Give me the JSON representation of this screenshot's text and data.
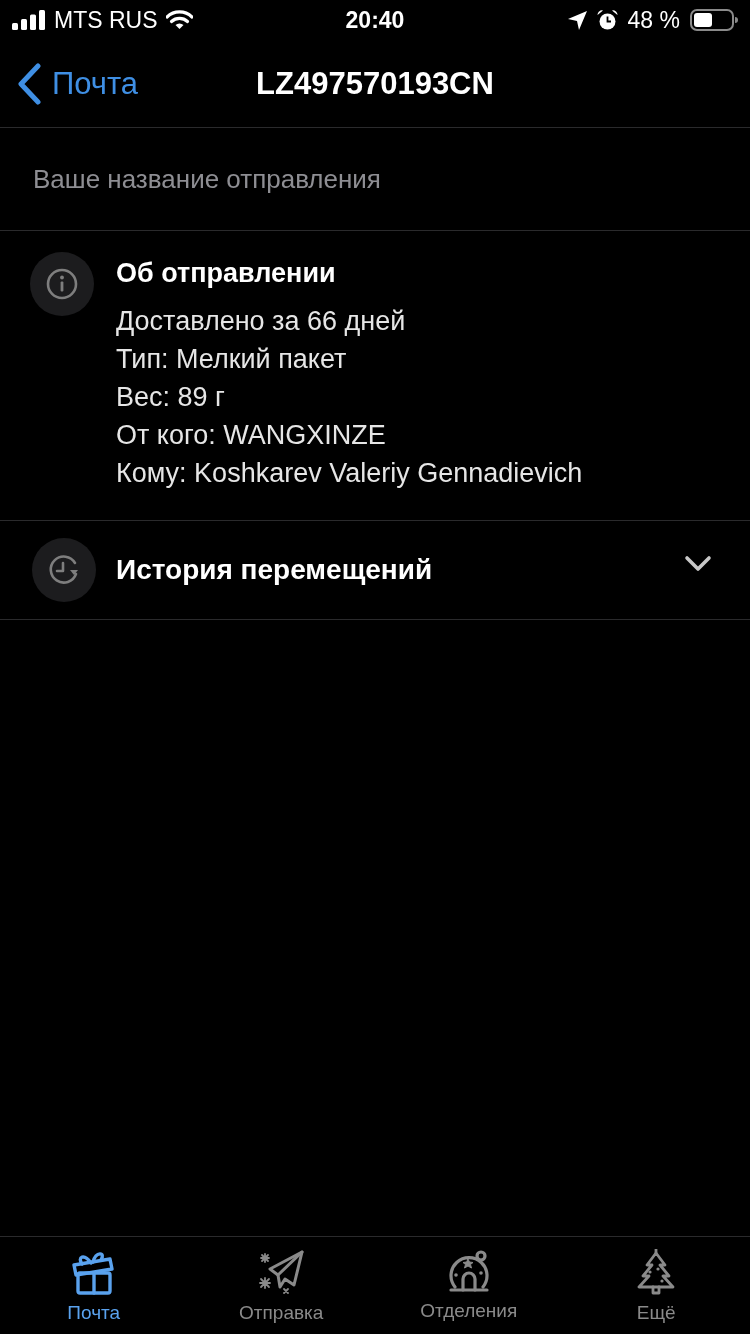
{
  "status_bar": {
    "carrier": "MTS RUS",
    "time": "20:40",
    "battery": "48 %"
  },
  "nav": {
    "back_label": "Почта",
    "title": "LZ497570193CN"
  },
  "name_field": {
    "placeholder": "Ваше название отправления"
  },
  "sections": [
    {
      "kind": "details",
      "title": "Об отправлении",
      "lines": [
        "Доставлено за 66 дней",
        "Тип: Мелкий пакет",
        "Вес: 89 г",
        "От кого: WANGXINZE",
        "Кому: Koshkarev Valeriy Gennadievich"
      ]
    },
    {
      "kind": "collapsible",
      "title": "История перемещений",
      "expanded": false
    }
  ],
  "tab_bar": [
    {
      "label": "Почта",
      "selected": true
    },
    {
      "label": "Отправка",
      "selected": false
    },
    {
      "label": "Отделения",
      "selected": false
    },
    {
      "label": "Ещё",
      "selected": false
    }
  ]
}
